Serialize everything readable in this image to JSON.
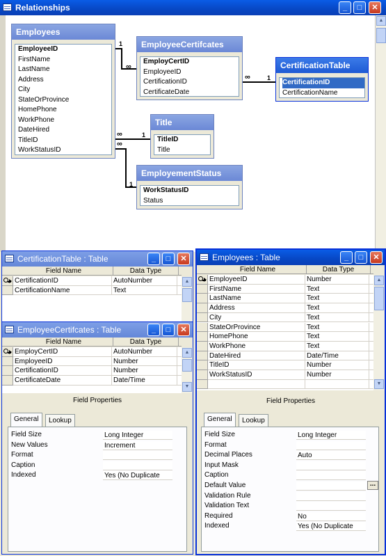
{
  "relationships": {
    "title": "Relationships",
    "tables": {
      "employees": {
        "title": "Employees",
        "fields": [
          "EmployeeID",
          "FirstName",
          "LastName",
          "Address",
          "City",
          "StateOrProvince",
          "HomePhone",
          "WorkPhone",
          "DateHired",
          "TitleID",
          "WorkStatusID"
        ]
      },
      "employee_certifcates": {
        "title": "EmployeeCertifcates",
        "fields": [
          "EmployCertID",
          "EmployeeID",
          "CertificationID",
          "CertificateDate"
        ]
      },
      "certification_table": {
        "title": "CertificationTable",
        "fields": [
          "CertificationID",
          "CertificationName"
        ]
      },
      "title_table": {
        "title": "Title",
        "fields": [
          "TitleID",
          "Title"
        ]
      },
      "employment_status": {
        "title": "EmployementStatus",
        "fields": [
          "WorkStatusID",
          "Status"
        ]
      }
    },
    "cardinality": {
      "one": "1",
      "many": "∞"
    }
  },
  "cert_window": {
    "title": "CertificationTable : Table",
    "col_field": "Field Name",
    "col_type": "Data Type",
    "rows": [
      [
        "CertificationID",
        "AutoNumber"
      ],
      [
        "CertificationName",
        "Text"
      ]
    ]
  },
  "empcert_window": {
    "title": "EmployeeCertifcates : Table",
    "col_field": "Field Name",
    "col_type": "Data Type",
    "rows": [
      [
        "EmployCertID",
        "AutoNumber"
      ],
      [
        "EmployeeID",
        "Number"
      ],
      [
        "CertificationID",
        "Number"
      ],
      [
        "CertificateDate",
        "Date/Time"
      ]
    ],
    "field_properties": "Field Properties",
    "tabs": [
      "General",
      "Lookup"
    ],
    "properties": [
      [
        "Field Size",
        "Long Integer"
      ],
      [
        "New Values",
        "Increment"
      ],
      [
        "Format",
        ""
      ],
      [
        "Caption",
        ""
      ],
      [
        "Indexed",
        "Yes (No Duplicate"
      ]
    ]
  },
  "employees_window": {
    "title": "Employees : Table",
    "col_field": "Field Name",
    "col_type": "Data Type",
    "rows": [
      [
        "EmployeeID",
        "Number"
      ],
      [
        "FirstName",
        "Text"
      ],
      [
        "LastName",
        "Text"
      ],
      [
        "Address",
        "Text"
      ],
      [
        "City",
        "Text"
      ],
      [
        "StateOrProvince",
        "Text"
      ],
      [
        "HomePhone",
        "Text"
      ],
      [
        "WorkPhone",
        "Text"
      ],
      [
        "DateHired",
        "Date/Time"
      ],
      [
        "TitleID",
        "Number"
      ],
      [
        "WorkStatusID",
        "Number"
      ]
    ],
    "field_properties": "Field Properties",
    "tabs": [
      "General",
      "Lookup"
    ],
    "properties": [
      [
        "Field Size",
        "Long Integer"
      ],
      [
        "Format",
        ""
      ],
      [
        "Decimal Places",
        "Auto"
      ],
      [
        "Input Mask",
        ""
      ],
      [
        "Caption",
        ""
      ],
      [
        "Default Value",
        ""
      ],
      [
        "Validation Rule",
        ""
      ],
      [
        "Validation Text",
        ""
      ],
      [
        "Required",
        "No"
      ],
      [
        "Indexed",
        "Yes (No Duplicate"
      ]
    ]
  },
  "window_buttons": {
    "minimize": "_",
    "maximize": "□",
    "close": "✕"
  },
  "misc": {
    "dots": "..."
  }
}
